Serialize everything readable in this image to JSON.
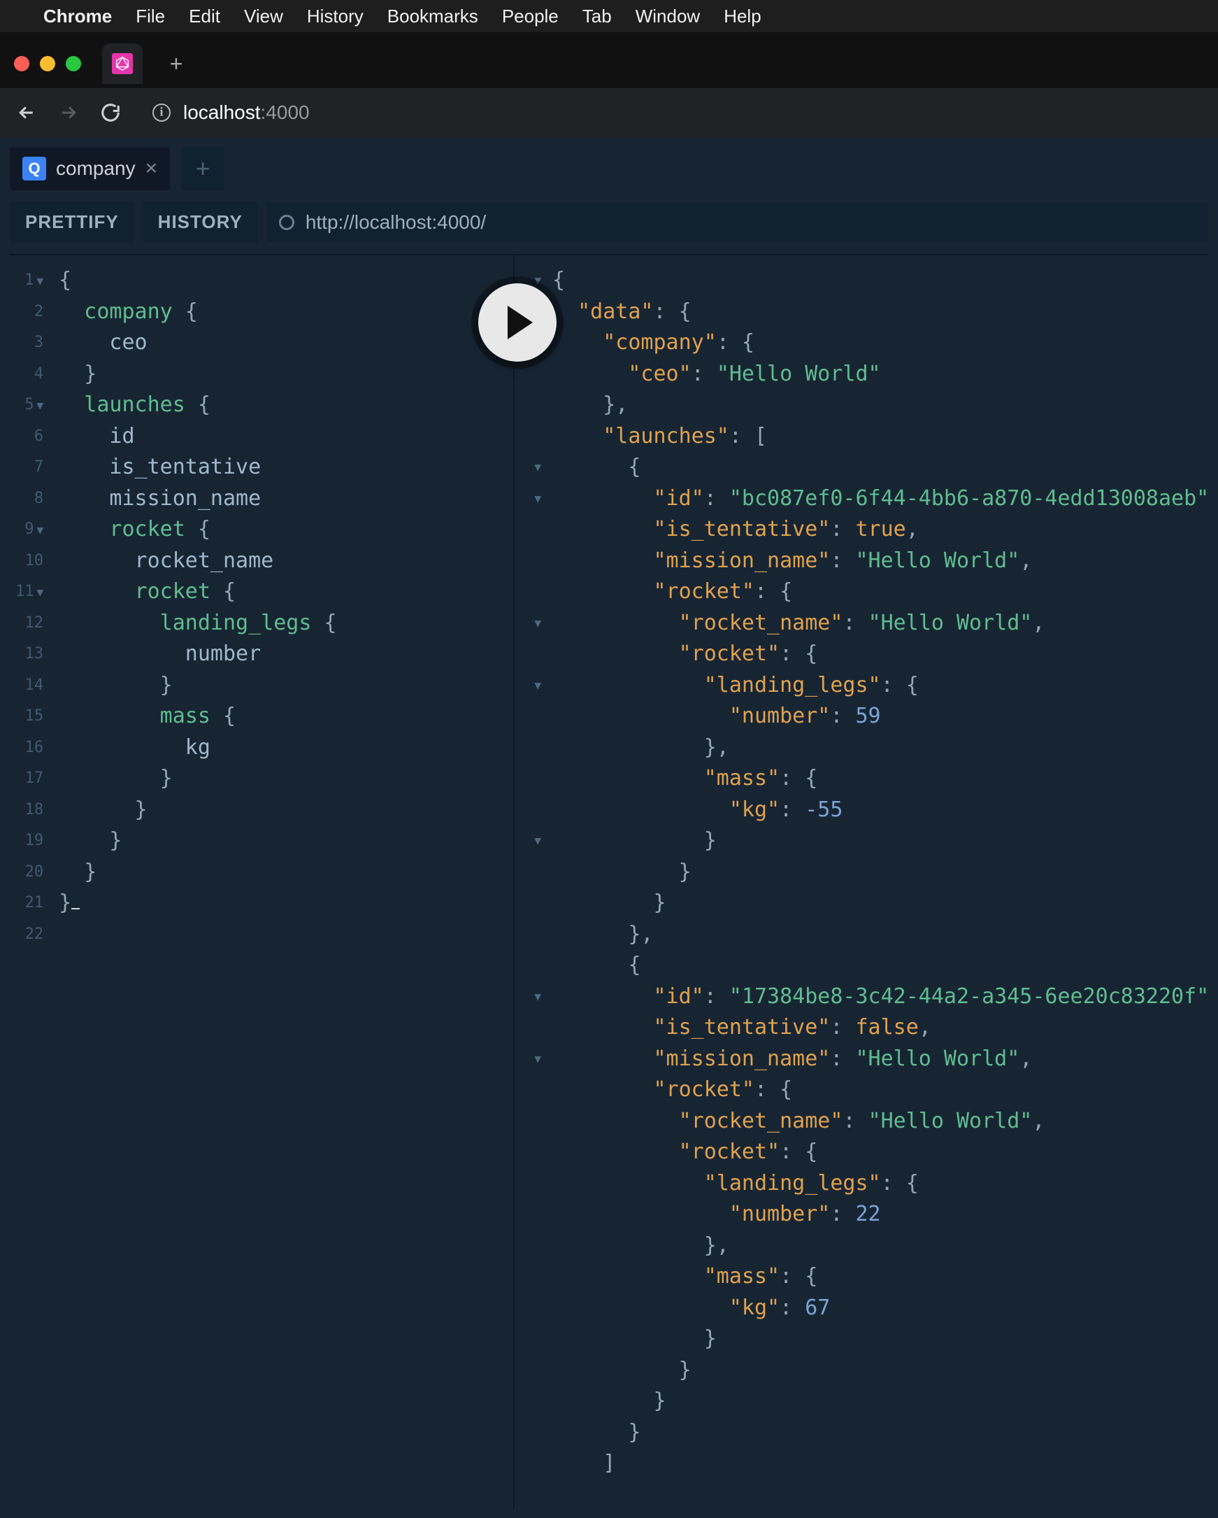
{
  "mac_menu": {
    "app_name": "Chrome",
    "items": [
      "File",
      "Edit",
      "View",
      "History",
      "Bookmarks",
      "People",
      "Tab",
      "Window",
      "Help"
    ]
  },
  "browser": {
    "url_host": "localhost",
    "url_port": ":4000"
  },
  "doc_tab": {
    "badge": "Q",
    "label": "company"
  },
  "controls": {
    "prettify": "PRETTIFY",
    "history": "HISTORY",
    "endpoint": "http://localhost:4000/"
  },
  "query": {
    "lines": [
      {
        "n": "1",
        "fold": true,
        "tokens": [
          {
            "t": "{",
            "c": "punct"
          }
        ]
      },
      {
        "n": "2",
        "tokens": [
          {
            "t": "  ",
            "c": ""
          },
          {
            "t": "company",
            "c": "kw-green"
          },
          {
            "t": " {",
            "c": "punct"
          }
        ]
      },
      {
        "n": "3",
        "tokens": [
          {
            "t": "    ",
            "c": ""
          },
          {
            "t": "ceo",
            "c": "kw-field"
          }
        ]
      },
      {
        "n": "4",
        "tokens": [
          {
            "t": "  }",
            "c": "punct"
          }
        ]
      },
      {
        "n": "5",
        "fold": true,
        "tokens": [
          {
            "t": "  ",
            "c": ""
          },
          {
            "t": "launches",
            "c": "kw-green"
          },
          {
            "t": " {",
            "c": "punct"
          }
        ]
      },
      {
        "n": "6",
        "tokens": [
          {
            "t": "    ",
            "c": ""
          },
          {
            "t": "id",
            "c": "kw-field"
          }
        ]
      },
      {
        "n": "7",
        "tokens": [
          {
            "t": "    ",
            "c": ""
          },
          {
            "t": "is_tentative",
            "c": "kw-field"
          }
        ]
      },
      {
        "n": "8",
        "tokens": [
          {
            "t": "    ",
            "c": ""
          },
          {
            "t": "mission_name",
            "c": "kw-field"
          }
        ]
      },
      {
        "n": "9",
        "fold": true,
        "tokens": [
          {
            "t": "    ",
            "c": ""
          },
          {
            "t": "rocket",
            "c": "kw-green"
          },
          {
            "t": " {",
            "c": "punct"
          }
        ]
      },
      {
        "n": "10",
        "tokens": [
          {
            "t": "      ",
            "c": ""
          },
          {
            "t": "rocket_name",
            "c": "kw-field"
          }
        ]
      },
      {
        "n": "11",
        "fold": true,
        "tokens": [
          {
            "t": "      ",
            "c": ""
          },
          {
            "t": "rocket",
            "c": "kw-green"
          },
          {
            "t": " {",
            "c": "punct"
          }
        ]
      },
      {
        "n": "12",
        "tokens": [
          {
            "t": "        ",
            "c": ""
          },
          {
            "t": "landing_legs",
            "c": "kw-green"
          },
          {
            "t": " {",
            "c": "punct"
          }
        ]
      },
      {
        "n": "13",
        "tokens": [
          {
            "t": "          ",
            "c": ""
          },
          {
            "t": "number",
            "c": "kw-field"
          }
        ]
      },
      {
        "n": "14",
        "tokens": [
          {
            "t": "        }",
            "c": "punct"
          }
        ]
      },
      {
        "n": "15",
        "tokens": [
          {
            "t": "        ",
            "c": ""
          },
          {
            "t": "mass",
            "c": "kw-green"
          },
          {
            "t": " {",
            "c": "punct"
          }
        ]
      },
      {
        "n": "16",
        "tokens": [
          {
            "t": "          ",
            "c": ""
          },
          {
            "t": "kg",
            "c": "kw-field"
          }
        ]
      },
      {
        "n": "17",
        "tokens": [
          {
            "t": "        }",
            "c": "punct"
          }
        ]
      },
      {
        "n": "18",
        "tokens": [
          {
            "t": "      }",
            "c": "punct"
          }
        ]
      },
      {
        "n": "19",
        "tokens": [
          {
            "t": "    }",
            "c": "punct"
          }
        ]
      },
      {
        "n": "20",
        "tokens": [
          {
            "t": "  }",
            "c": "punct"
          }
        ]
      },
      {
        "n": "21",
        "tokens": [
          {
            "t": "}",
            "c": "punct"
          },
          {
            "t": "",
            "c": "cursor"
          }
        ]
      },
      {
        "n": "22",
        "tokens": [
          {
            "t": "",
            "c": ""
          }
        ]
      }
    ]
  },
  "result": {
    "fold_rows": [
      0,
      1,
      6,
      7,
      11,
      13,
      18,
      23,
      25
    ],
    "lines": [
      [
        {
          "t": "{",
          "c": "j-punc"
        }
      ],
      [
        {
          "t": "  ",
          "c": ""
        },
        {
          "t": "\"data\"",
          "c": "j-key"
        },
        {
          "t": ": {",
          "c": "j-punc"
        }
      ],
      [
        {
          "t": "    ",
          "c": ""
        },
        {
          "t": "\"company\"",
          "c": "j-key"
        },
        {
          "t": ": {",
          "c": "j-punc"
        }
      ],
      [
        {
          "t": "      ",
          "c": ""
        },
        {
          "t": "\"ceo\"",
          "c": "j-key"
        },
        {
          "t": ": ",
          "c": "j-punc"
        },
        {
          "t": "\"Hello World\"",
          "c": "j-str"
        }
      ],
      [
        {
          "t": "    },",
          "c": "j-punc"
        }
      ],
      [
        {
          "t": "    ",
          "c": ""
        },
        {
          "t": "\"launches\"",
          "c": "j-key"
        },
        {
          "t": ": [",
          "c": "j-punc"
        }
      ],
      [
        {
          "t": "      {",
          "c": "j-punc"
        }
      ],
      [
        {
          "t": "        ",
          "c": ""
        },
        {
          "t": "\"id\"",
          "c": "j-key"
        },
        {
          "t": ": ",
          "c": "j-punc"
        },
        {
          "t": "\"bc087ef0-6f44-4bb6-a870-4edd13008aeb\"",
          "c": "j-str"
        },
        {
          "t": ",",
          "c": "j-punc"
        }
      ],
      [
        {
          "t": "        ",
          "c": ""
        },
        {
          "t": "\"is_tentative\"",
          "c": "j-key"
        },
        {
          "t": ": ",
          "c": "j-punc"
        },
        {
          "t": "true",
          "c": "j-true"
        },
        {
          "t": ",",
          "c": "j-punc"
        }
      ],
      [
        {
          "t": "        ",
          "c": ""
        },
        {
          "t": "\"mission_name\"",
          "c": "j-key"
        },
        {
          "t": ": ",
          "c": "j-punc"
        },
        {
          "t": "\"Hello World\"",
          "c": "j-str"
        },
        {
          "t": ",",
          "c": "j-punc"
        }
      ],
      [
        {
          "t": "        ",
          "c": ""
        },
        {
          "t": "\"rocket\"",
          "c": "j-key"
        },
        {
          "t": ": {",
          "c": "j-punc"
        }
      ],
      [
        {
          "t": "          ",
          "c": ""
        },
        {
          "t": "\"rocket_name\"",
          "c": "j-key"
        },
        {
          "t": ": ",
          "c": "j-punc"
        },
        {
          "t": "\"Hello World\"",
          "c": "j-str"
        },
        {
          "t": ",",
          "c": "j-punc"
        }
      ],
      [
        {
          "t": "          ",
          "c": ""
        },
        {
          "t": "\"rocket\"",
          "c": "j-key"
        },
        {
          "t": ": {",
          "c": "j-punc"
        }
      ],
      [
        {
          "t": "            ",
          "c": ""
        },
        {
          "t": "\"landing_legs\"",
          "c": "j-key"
        },
        {
          "t": ": {",
          "c": "j-punc"
        }
      ],
      [
        {
          "t": "              ",
          "c": ""
        },
        {
          "t": "\"number\"",
          "c": "j-key"
        },
        {
          "t": ": ",
          "c": "j-punc"
        },
        {
          "t": "59",
          "c": "j-num"
        }
      ],
      [
        {
          "t": "            },",
          "c": "j-punc"
        }
      ],
      [
        {
          "t": "            ",
          "c": ""
        },
        {
          "t": "\"mass\"",
          "c": "j-key"
        },
        {
          "t": ": {",
          "c": "j-punc"
        }
      ],
      [
        {
          "t": "              ",
          "c": ""
        },
        {
          "t": "\"kg\"",
          "c": "j-key"
        },
        {
          "t": ": ",
          "c": "j-punc"
        },
        {
          "t": "-55",
          "c": "j-num"
        }
      ],
      [
        {
          "t": "            }",
          "c": "j-punc"
        }
      ],
      [
        {
          "t": "          }",
          "c": "j-punc"
        }
      ],
      [
        {
          "t": "        }",
          "c": "j-punc"
        }
      ],
      [
        {
          "t": "      },",
          "c": "j-punc"
        }
      ],
      [
        {
          "t": "      {",
          "c": "j-punc"
        }
      ],
      [
        {
          "t": "        ",
          "c": ""
        },
        {
          "t": "\"id\"",
          "c": "j-key"
        },
        {
          "t": ": ",
          "c": "j-punc"
        },
        {
          "t": "\"17384be8-3c42-44a2-a345-6ee20c83220f\"",
          "c": "j-str"
        },
        {
          "t": ",",
          "c": "j-punc"
        }
      ],
      [
        {
          "t": "        ",
          "c": ""
        },
        {
          "t": "\"is_tentative\"",
          "c": "j-key"
        },
        {
          "t": ": ",
          "c": "j-punc"
        },
        {
          "t": "false",
          "c": "j-false"
        },
        {
          "t": ",",
          "c": "j-punc"
        }
      ],
      [
        {
          "t": "        ",
          "c": ""
        },
        {
          "t": "\"mission_name\"",
          "c": "j-key"
        },
        {
          "t": ": ",
          "c": "j-punc"
        },
        {
          "t": "\"Hello World\"",
          "c": "j-str"
        },
        {
          "t": ",",
          "c": "j-punc"
        }
      ],
      [
        {
          "t": "        ",
          "c": ""
        },
        {
          "t": "\"rocket\"",
          "c": "j-key"
        },
        {
          "t": ": {",
          "c": "j-punc"
        }
      ],
      [
        {
          "t": "          ",
          "c": ""
        },
        {
          "t": "\"rocket_name\"",
          "c": "j-key"
        },
        {
          "t": ": ",
          "c": "j-punc"
        },
        {
          "t": "\"Hello World\"",
          "c": "j-str"
        },
        {
          "t": ",",
          "c": "j-punc"
        }
      ],
      [
        {
          "t": "          ",
          "c": ""
        },
        {
          "t": "\"rocket\"",
          "c": "j-key"
        },
        {
          "t": ": {",
          "c": "j-punc"
        }
      ],
      [
        {
          "t": "            ",
          "c": ""
        },
        {
          "t": "\"landing_legs\"",
          "c": "j-key"
        },
        {
          "t": ": {",
          "c": "j-punc"
        }
      ],
      [
        {
          "t": "              ",
          "c": ""
        },
        {
          "t": "\"number\"",
          "c": "j-key"
        },
        {
          "t": ": ",
          "c": "j-punc"
        },
        {
          "t": "22",
          "c": "j-num"
        }
      ],
      [
        {
          "t": "            },",
          "c": "j-punc"
        }
      ],
      [
        {
          "t": "            ",
          "c": ""
        },
        {
          "t": "\"mass\"",
          "c": "j-key"
        },
        {
          "t": ": {",
          "c": "j-punc"
        }
      ],
      [
        {
          "t": "              ",
          "c": ""
        },
        {
          "t": "\"kg\"",
          "c": "j-key"
        },
        {
          "t": ": ",
          "c": "j-punc"
        },
        {
          "t": "67",
          "c": "j-num"
        }
      ],
      [
        {
          "t": "            }",
          "c": "j-punc"
        }
      ],
      [
        {
          "t": "          }",
          "c": "j-punc"
        }
      ],
      [
        {
          "t": "        }",
          "c": "j-punc"
        }
      ],
      [
        {
          "t": "      }",
          "c": "j-punc"
        }
      ],
      [
        {
          "t": "    ]",
          "c": "j-punc"
        }
      ]
    ]
  }
}
